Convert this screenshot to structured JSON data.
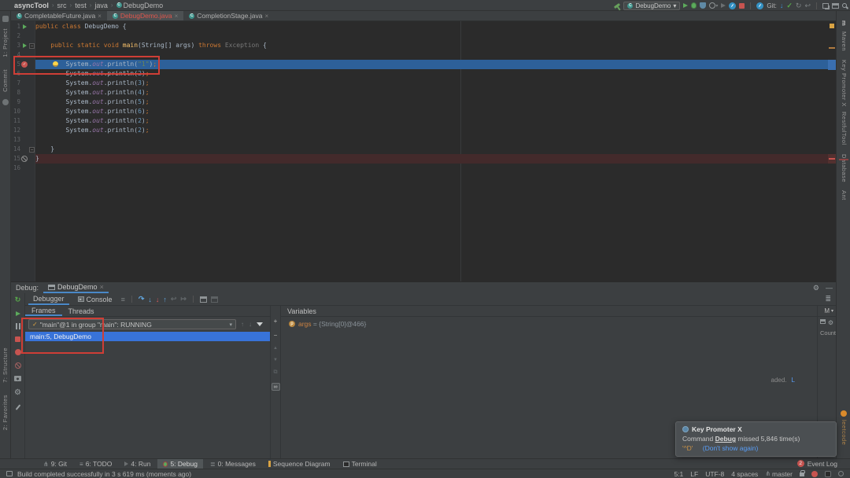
{
  "icons": {
    "chevron": "›",
    "close": "×",
    "caret_down": "▾",
    "check": "✓",
    "menu": "≡",
    "menu_lines": "≣",
    "gear": "⚙",
    "minimize": "—",
    "rerun": "↻",
    "step_over": "↷",
    "step_into": "↓",
    "force_step_into": "↓",
    "step_out": "↑",
    "drop_frame": "↩",
    "run_to_cursor": "↦",
    "move_up": "▲",
    "move_down": "▼",
    "add": "+",
    "remove": "−",
    "duplicate": "⧉",
    "infinity": "∞",
    "branch": "⋔",
    "class_letter": "C",
    "param_letter": "p",
    "up": "↑",
    "down": "↓",
    "fold": "−",
    "maven_letter": "m"
  },
  "breadcrumbs": [
    "asyncTool",
    "src",
    "test",
    "java",
    "DebugDemo"
  ],
  "main_toolbar": {
    "run_config": "DebugDemo",
    "git_label": "Git:"
  },
  "editor_tabs": [
    {
      "label": "CompletableFuture.java"
    },
    {
      "label": "DebugDemo.java"
    },
    {
      "label": "CompletionStage.java"
    }
  ],
  "editor": {
    "lines": [
      {
        "n": "1",
        "gutter": "run",
        "tokens": [
          {
            "c": "kw",
            "t": "public class "
          },
          {
            "c": "pln",
            "t": "DebugDemo {"
          }
        ]
      },
      {
        "n": "2",
        "tokens": []
      },
      {
        "n": "3",
        "gutter": "run",
        "fold": true,
        "tokens": [
          {
            "c": "pln",
            "t": "    "
          },
          {
            "c": "kw",
            "t": "public static void "
          },
          {
            "c": "meth",
            "t": "main"
          },
          {
            "c": "pln",
            "t": "(String[] args) "
          },
          {
            "c": "kw",
            "t": "throws "
          },
          {
            "c": "gray",
            "t": "Exception "
          },
          {
            "c": "pln",
            "t": "{"
          }
        ]
      },
      {
        "n": "4",
        "tokens": []
      },
      {
        "n": "5",
        "gutter": "bp",
        "exec": true,
        "bulb": true,
        "tokens": [
          {
            "c": "pln",
            "t": "        System."
          },
          {
            "c": "fld",
            "t": "out"
          },
          {
            "c": "pln",
            "t": ".println("
          },
          {
            "c": "str",
            "t": "\"1\""
          },
          {
            "c": "pln",
            "t": ")"
          },
          {
            "c": "semi",
            "t": ";"
          }
        ]
      },
      {
        "n": "6",
        "tokens": [
          {
            "c": "pln",
            "t": "        System."
          },
          {
            "c": "fld",
            "t": "out"
          },
          {
            "c": "pln",
            "t": ".println("
          },
          {
            "c": "num",
            "t": "2"
          },
          {
            "c": "pln",
            "t": ")"
          },
          {
            "c": "semi",
            "t": ";"
          }
        ]
      },
      {
        "n": "7",
        "tokens": [
          {
            "c": "pln",
            "t": "        System."
          },
          {
            "c": "fld",
            "t": "out"
          },
          {
            "c": "pln",
            "t": ".println("
          },
          {
            "c": "num",
            "t": "3"
          },
          {
            "c": "pln",
            "t": ")"
          },
          {
            "c": "semi",
            "t": ";"
          }
        ]
      },
      {
        "n": "8",
        "tokens": [
          {
            "c": "pln",
            "t": "        System."
          },
          {
            "c": "fld",
            "t": "out"
          },
          {
            "c": "pln",
            "t": ".println("
          },
          {
            "c": "num",
            "t": "4"
          },
          {
            "c": "pln",
            "t": ")"
          },
          {
            "c": "semi",
            "t": ";"
          }
        ]
      },
      {
        "n": "9",
        "tokens": [
          {
            "c": "pln",
            "t": "        System."
          },
          {
            "c": "fld",
            "t": "out"
          },
          {
            "c": "pln",
            "t": ".println("
          },
          {
            "c": "num",
            "t": "5"
          },
          {
            "c": "pln",
            "t": ")"
          },
          {
            "c": "semi",
            "t": ";"
          }
        ]
      },
      {
        "n": "10",
        "tokens": [
          {
            "c": "pln",
            "t": "        System."
          },
          {
            "c": "fld",
            "t": "out"
          },
          {
            "c": "pln",
            "t": ".println("
          },
          {
            "c": "num",
            "t": "6"
          },
          {
            "c": "pln",
            "t": ")"
          },
          {
            "c": "semi",
            "t": ";"
          }
        ]
      },
      {
        "n": "11",
        "tokens": [
          {
            "c": "pln",
            "t": "        System."
          },
          {
            "c": "fld",
            "t": "out"
          },
          {
            "c": "pln",
            "t": ".println("
          },
          {
            "c": "num",
            "t": "2"
          },
          {
            "c": "pln",
            "t": ")"
          },
          {
            "c": "semi",
            "t": ";"
          }
        ]
      },
      {
        "n": "12",
        "tokens": [
          {
            "c": "pln",
            "t": "        System."
          },
          {
            "c": "fld",
            "t": "out"
          },
          {
            "c": "pln",
            "t": ".println("
          },
          {
            "c": "num",
            "t": "2"
          },
          {
            "c": "pln",
            "t": ")"
          },
          {
            "c": "semi",
            "t": ";"
          }
        ]
      },
      {
        "n": "13",
        "tokens": []
      },
      {
        "n": "14",
        "fold": true,
        "tokens": [
          {
            "c": "pln",
            "t": "    }"
          }
        ]
      },
      {
        "n": "15",
        "gutter": "bp-invalid",
        "err": true,
        "tokens": [
          {
            "c": "pln",
            "t": "}"
          }
        ]
      },
      {
        "n": "16",
        "tokens": []
      }
    ]
  },
  "debug": {
    "label": "Debug:",
    "session_tab": "DebugDemo",
    "debugger_tab": "Debugger",
    "console_tab": "Console",
    "frames_tab": "Frames",
    "threads_tab": "Threads",
    "variables_label": "Variables",
    "memory_label": "M",
    "thread_dropdown": "\"main\"@1 in group \"main\": RUNNING",
    "frames": [
      {
        "label": "main:5, DebugDemo"
      }
    ],
    "variables": [
      {
        "name": "args",
        "sep": " = ",
        "value": "{String[0]@466}"
      }
    ],
    "memory": {
      "count_header": "Count",
      "loaded_tail": "aded.",
      "loaded_link": "L"
    }
  },
  "bottom_bar": {
    "items": [
      {
        "label": "9: Git"
      },
      {
        "label": "6: TODO"
      },
      {
        "label": "4: Run"
      },
      {
        "label": "5: Debug"
      },
      {
        "label": "0: Messages"
      },
      {
        "label": "Sequence Diagram"
      },
      {
        "label": "Terminal"
      }
    ],
    "event_log_badge": "2",
    "event_log_label": "Event Log"
  },
  "status_bar": {
    "message": "Build completed successfully in 3 s 619 ms (moments ago)",
    "position": "5:1",
    "line_ending": "LF",
    "encoding": "UTF-8",
    "indent": "4 spaces",
    "branch": "master"
  },
  "notification": {
    "title": "Key Promoter X",
    "body_prefix": "Command ",
    "command": "Debug",
    "body_suffix": " missed 5,846 time(s)",
    "shortcut": "'^D'",
    "dismiss": "(Don't show again)"
  },
  "left_stripe": {
    "top": [
      "1: Project",
      "Commit"
    ],
    "bottom": [
      "7: Structure",
      "2: Favorites"
    ]
  },
  "right_stripe": {
    "top": [
      "Maven",
      "Key Promoter X",
      "RestfulTool",
      "Database",
      "Ant"
    ],
    "bottom": [
      "leetcode"
    ]
  },
  "colors": {
    "accent_blue": "#4a88c7",
    "execution_line": "#2d6099",
    "selection_blue": "#3873d9",
    "error_red": "#cf3e36",
    "string_green": "#6a8759",
    "number_blue": "#6897bb",
    "keyword_orange": "#cc7832"
  }
}
